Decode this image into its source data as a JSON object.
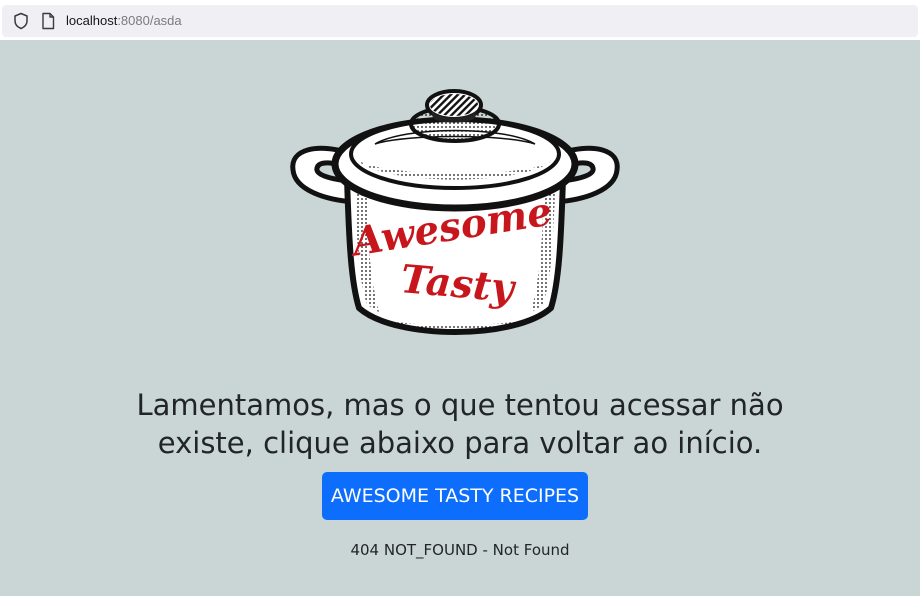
{
  "browser": {
    "url_host": "localhost",
    "url_rest": ":8080/asda"
  },
  "logo": {
    "line1": "Awesome",
    "line2": "Tasty",
    "text_color": "#c8161d"
  },
  "page": {
    "message": "Lamentamos, mas o que tentou acessar não existe, clique abaixo para voltar ao início.",
    "button_label": "AWESOME TASTY RECIPES",
    "status": "404 NOT_FOUND - Not Found",
    "background_color": "#cad6d6",
    "button_color": "#0d6efd"
  }
}
